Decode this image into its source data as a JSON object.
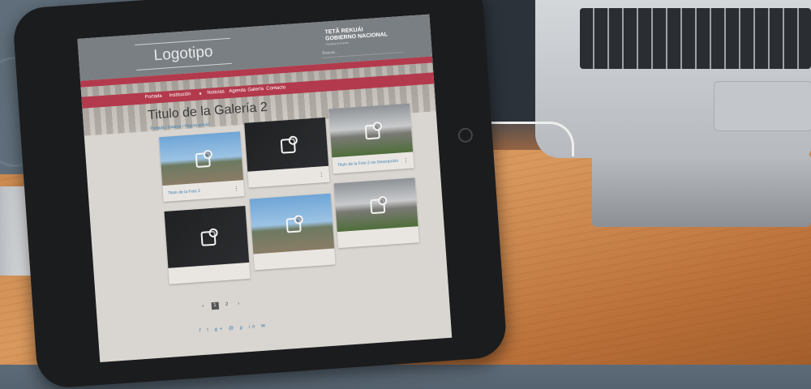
{
  "site": {
    "logo": "Logotipo",
    "gov_line1": "TETÃ REKUÁI",
    "gov_line2": "GOBIERNO NACIONAL",
    "gov_sub": "Paraguay de la gente",
    "search_placeholder": "Buscar..."
  },
  "nav": {
    "items": [
      {
        "label": "Portada"
      },
      {
        "label": "Institución"
      },
      {
        "label": "Noticias"
      },
      {
        "label": "Agenda"
      },
      {
        "label": "Galería"
      },
      {
        "label": "Contacto"
      }
    ]
  },
  "page": {
    "title": "Titulo de la Galería 2",
    "breadcrumb": "Portada / Galería / Página actual"
  },
  "gallery": {
    "cards": [
      {
        "caption": "Titulo de la Foto 3",
        "style": "sky"
      },
      {
        "caption": "",
        "style": "dark"
      },
      {
        "caption": "Titulo de la Foto 2 sin Descripción",
        "style": "old"
      },
      {
        "caption": "",
        "style": "dark"
      },
      {
        "caption": "",
        "style": "sky"
      },
      {
        "caption": "",
        "style": "old"
      }
    ]
  },
  "pagination": {
    "prev": "‹",
    "pages": [
      "1",
      "2"
    ],
    "active": "1",
    "next": "›"
  },
  "social": {
    "icons": "f t g+ @ p in ✉"
  },
  "colors": {
    "accent": "#b23a4c",
    "header": "#7a7f83",
    "link": "#3b7fb0"
  }
}
